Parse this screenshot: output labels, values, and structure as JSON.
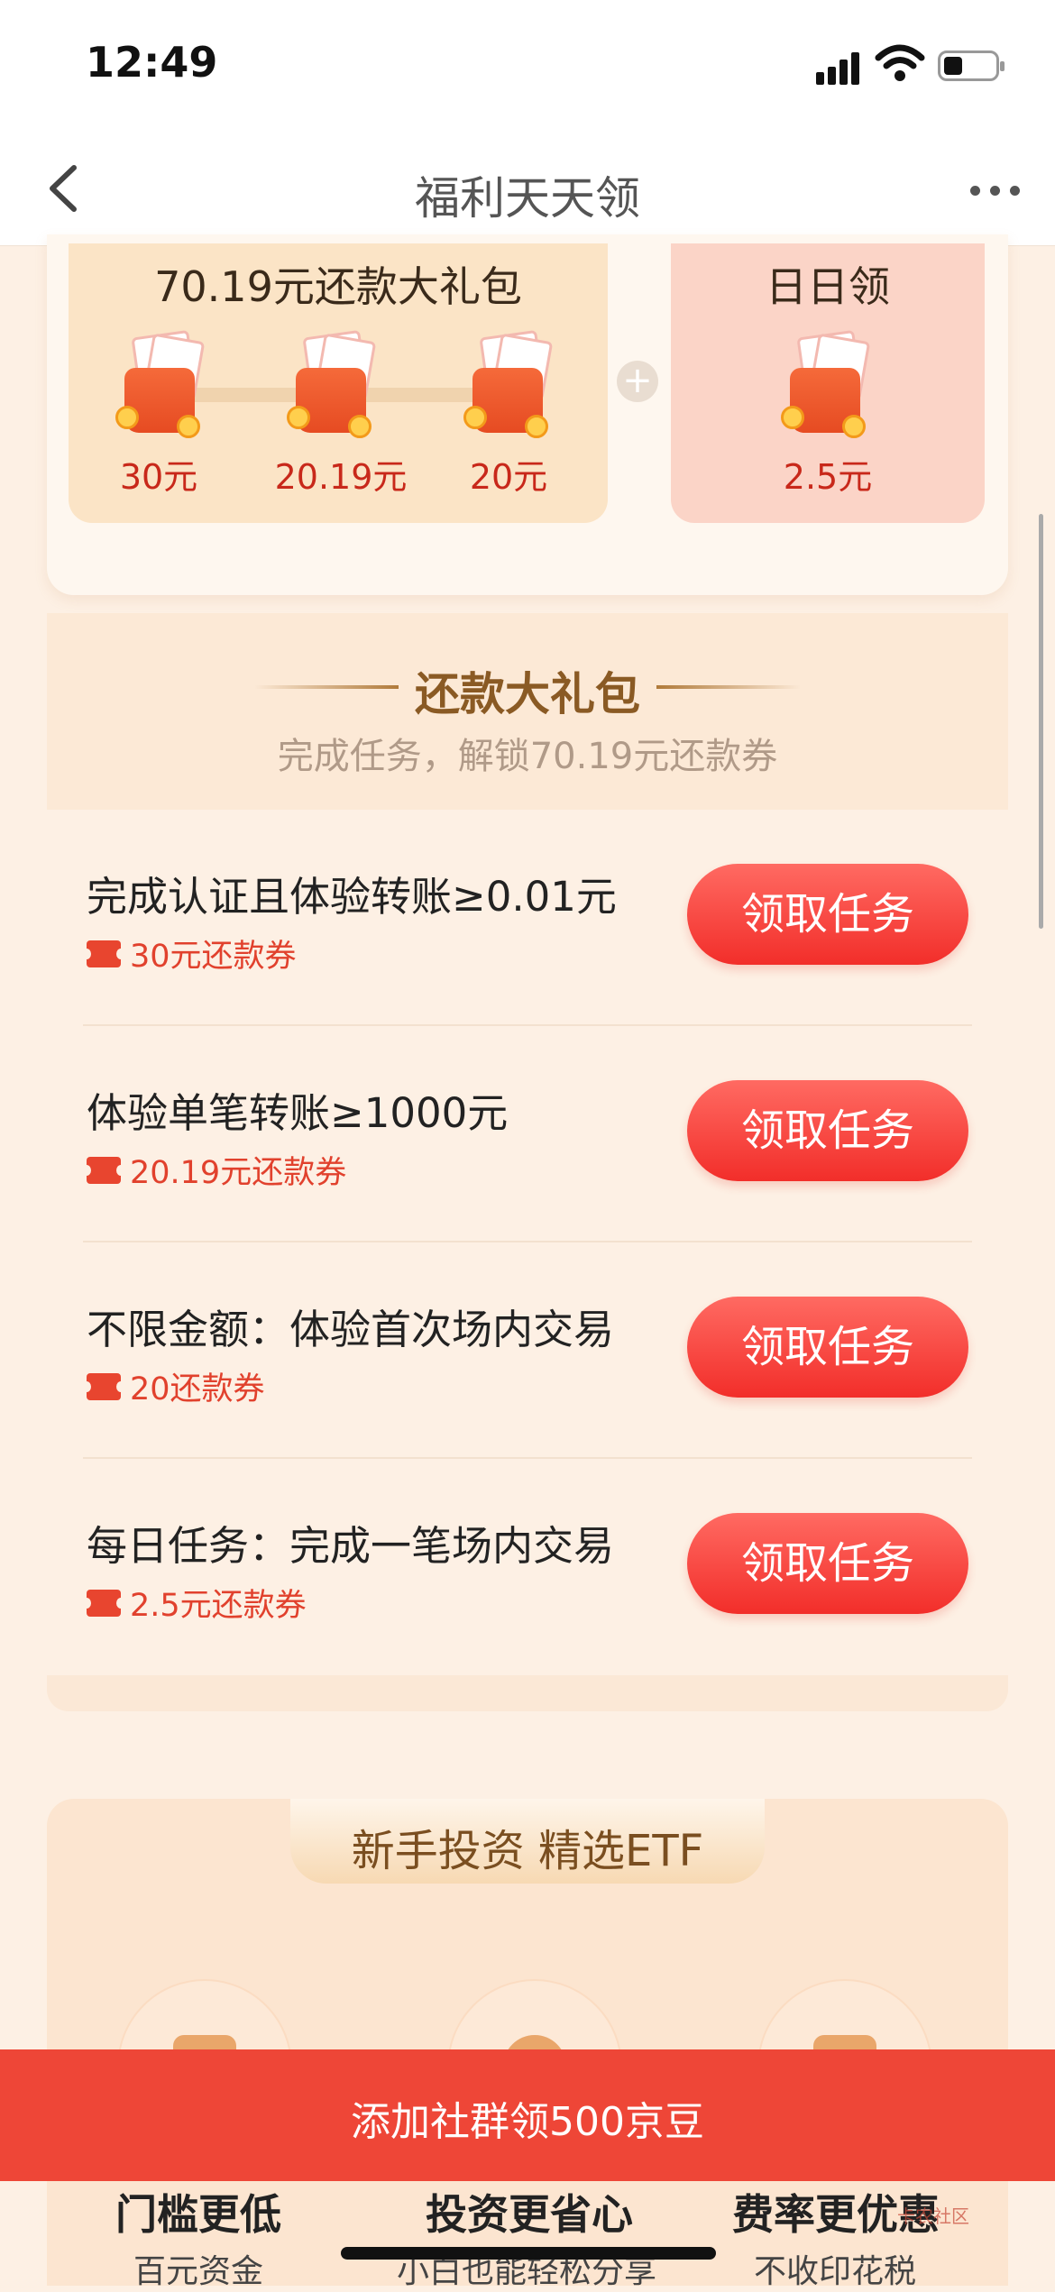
{
  "status_bar": {
    "time": "12:49"
  },
  "nav": {
    "title": "福利天天领"
  },
  "package": {
    "title": "70.19元还款大礼包",
    "amounts": [
      "30元",
      "20.19元",
      "20元"
    ],
    "daily_title": "日日领",
    "daily_amount": "2.5元",
    "plus": "+"
  },
  "section": {
    "title": "还款大礼包",
    "subtitle": "完成任务，解锁70.19元还款券"
  },
  "tasks": [
    {
      "name": "完成认证且体验转账≥0.01元",
      "coupon": "30元还款券",
      "button": "领取任务"
    },
    {
      "name": "体验单笔转账≥1000元",
      "coupon": "20.19元还款券",
      "button": "领取任务"
    },
    {
      "name": "不限金额：体验首次场内交易",
      "coupon": "20还款券",
      "button": "领取任务"
    },
    {
      "name": "每日任务：完成一笔场内交易",
      "coupon": "2.5元还款券",
      "button": "领取任务"
    }
  ],
  "etf": {
    "title": "新手投资 精选ETF",
    "features": [
      {
        "title": "门槛更低",
        "sub": "百元资金"
      },
      {
        "title": "投资更省心",
        "sub": "小白也能轻松分享"
      },
      {
        "title": "费率更优惠",
        "sub": "不收印花税"
      }
    ]
  },
  "banner": {
    "text": "添加社群领500京豆"
  },
  "watermark": {
    "text": "卡农社区"
  }
}
